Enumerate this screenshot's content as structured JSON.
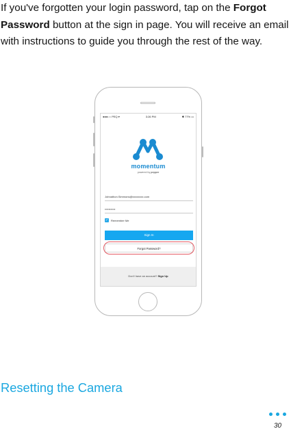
{
  "intro": {
    "part1": "If you've forgotten your login password, tap on the ",
    "link": "Forgot Password",
    "part2": " button at the sign in page. You will receive an email with instructions to guide you through the rest of the way."
  },
  "phone": {
    "status_left": "●●●○○ PEQ ▾",
    "status_time": "3:26 PM",
    "status_right": "✱ 77% ▭",
    "brand": "momentum",
    "powered_prefix": "powered by",
    "powered_brand": "pepper",
    "email_value": "Johnathon.Simmons@xxxxxxxx.com",
    "password_value": "•••••••••••",
    "remember_label": "Remember Me",
    "signin_label": "Sign In",
    "forgot_label": "Forgot Password?",
    "footer_text": "Don't have an account?",
    "footer_signup": "Sign Up",
    "colors": {
      "accent": "#16a7f0",
      "highlight": "#e45a63"
    }
  },
  "section_heading": "Resetting the Camera",
  "page_number": "30"
}
